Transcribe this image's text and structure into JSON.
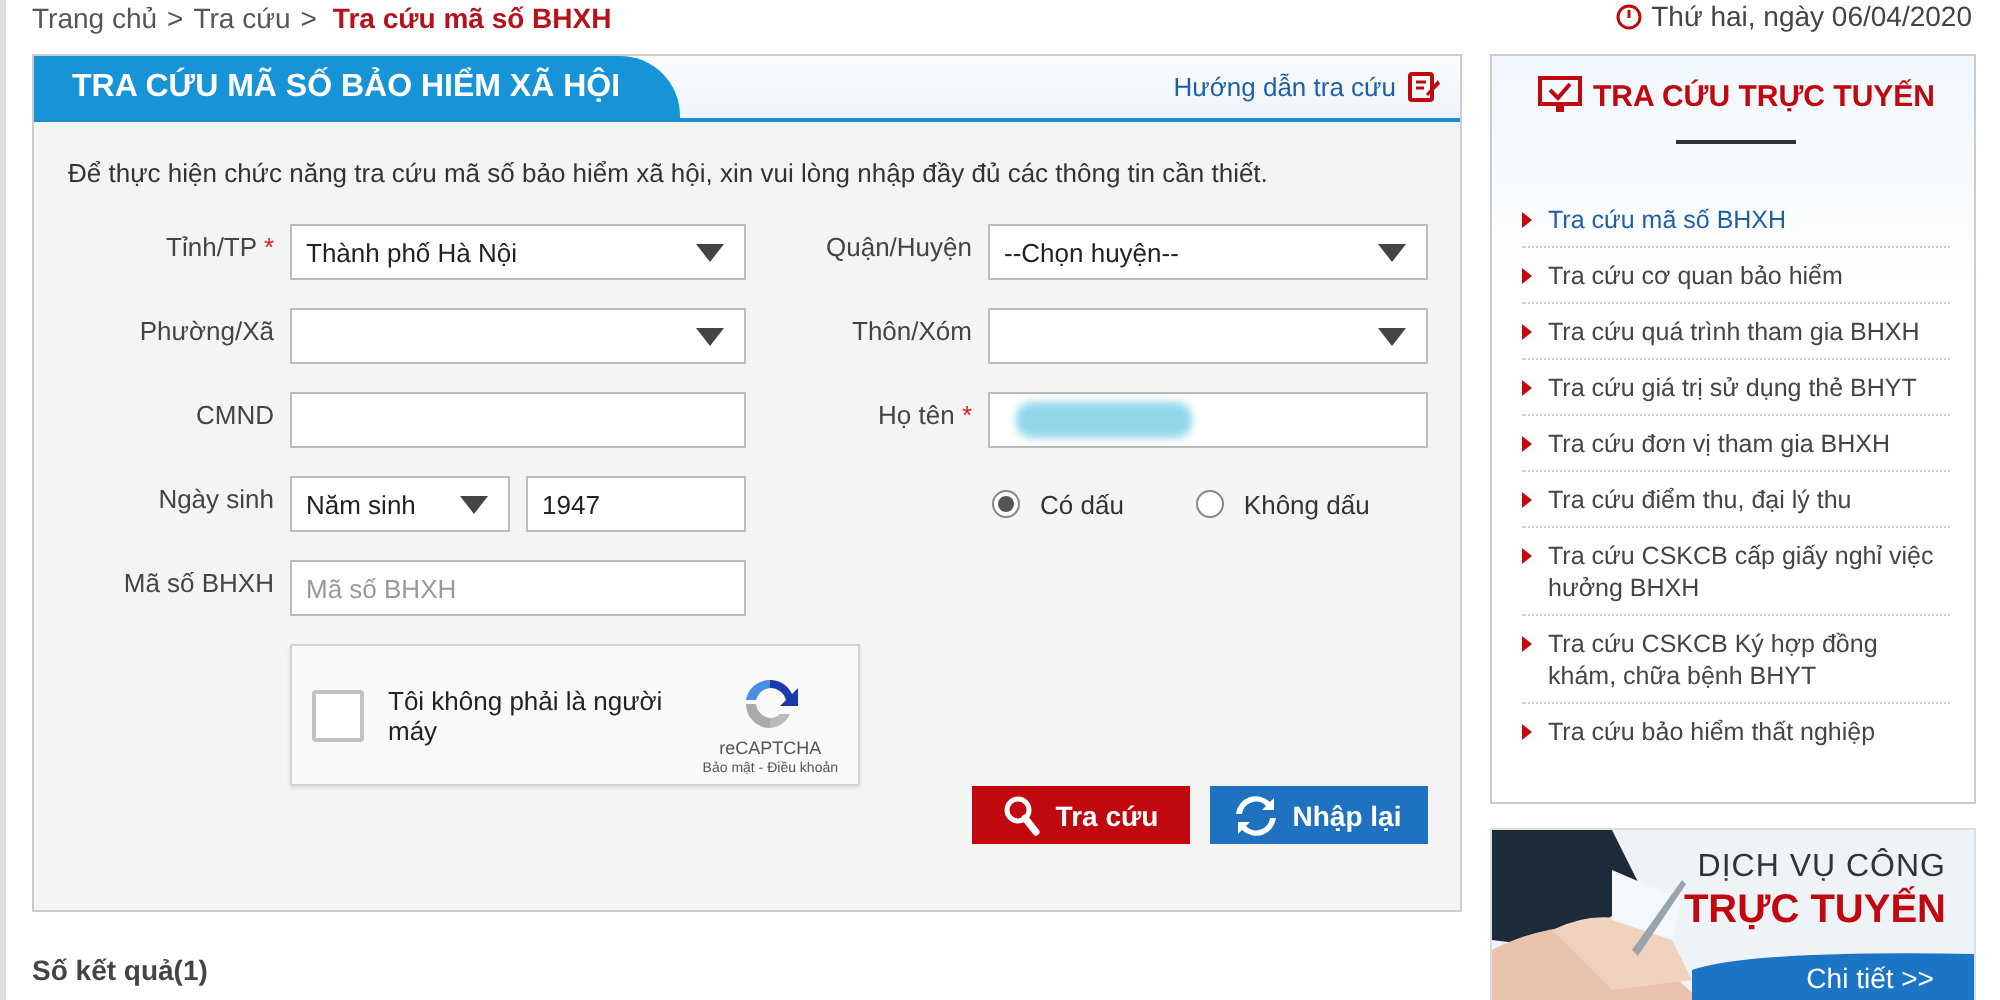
{
  "breadcrumb": [
    {
      "label": "Trang chủ",
      "separator": ">",
      "current": false
    },
    {
      "label": "Tra cứu",
      "separator": ">",
      "current": false
    },
    {
      "label": "Tra cứu mã số BHXH",
      "current": true
    }
  ],
  "date": "Thứ hai, ngày 06/04/2020",
  "panel": {
    "title": "TRA CỨU MÃ SỐ BẢO HIỂM XÃ HỘI",
    "help_link": "Hướng dẫn tra cứu",
    "intro": "Để thực hiện chức năng tra cứu mã số bảo hiểm xã hội, xin vui lòng nhập đầy đủ các thông tin cần thiết."
  },
  "form_rows": [
    [
      {
        "kind": "select",
        "label": "Tỉnh/TP",
        "required_mark": "*",
        "value": "Thành phố Hà Nội"
      },
      {
        "kind": "select",
        "label": "Quận/Huyện",
        "value": "--Chọn huyện--"
      }
    ],
    [
      {
        "kind": "select",
        "label": "Phường/Xã"
      },
      {
        "kind": "select",
        "label": "Thôn/Xóm"
      }
    ],
    [
      {
        "kind": "text",
        "label": "CMND"
      },
      {
        "kind": "text",
        "label": "Họ tên",
        "required_mark": "*",
        "redacted": true
      }
    ],
    [
      {
        "kind": "birth",
        "label": "Ngày sinh",
        "select_value": "Năm sinh",
        "value": "1947"
      },
      {
        "kind": "radio",
        "options": [
          {
            "label": "Có dấu",
            "selected": true
          },
          {
            "label": "Không dấu",
            "selected": false
          }
        ]
      }
    ],
    [
      {
        "kind": "text",
        "label": "Mã số BHXH",
        "placeholder": "Mã số BHXH"
      }
    ]
  ],
  "captcha": {
    "label": "Tôi không phải là người máy",
    "checked": false,
    "brand": "reCAPTCHA",
    "links": "Bảo mật - Điều khoản"
  },
  "buttons": [
    {
      "kind": "search",
      "label": "Tra cứu"
    },
    {
      "kind": "reset",
      "label": "Nhập lại"
    }
  ],
  "results": "Số kết quả(1)",
  "sidebar": {
    "title": "TRA CỨU TRỰC TUYẾN",
    "items": [
      {
        "label": "Tra cứu mã số BHXH",
        "selected": true
      },
      {
        "label": "Tra cứu cơ quan bảo hiểm",
        "selected": false
      },
      {
        "label": "Tra cứu quá trình tham gia BHXH",
        "selected": false
      },
      {
        "label": "Tra cứu giá trị sử dụng thẻ BHYT",
        "selected": false
      },
      {
        "label": "Tra cứu đơn vị tham gia BHXH",
        "selected": false
      },
      {
        "label": "Tra cứu điểm thu, đại lý thu",
        "selected": false
      },
      {
        "label": "Tra cứu CSKCB cấp giấy nghỉ việc hưởng BHXH",
        "selected": false
      },
      {
        "label": "Tra cứu CSKCB Ký hợp đồng khám, chữa bệnh BHYT",
        "selected": false
      },
      {
        "label": "Tra cứu bảo hiểm thất nghiệp",
        "selected": false
      }
    ]
  },
  "banner": {
    "line1": "DỊCH VỤ CÔNG",
    "line2": "TRỰC TUYẾN",
    "link": "Chi tiết >>"
  }
}
